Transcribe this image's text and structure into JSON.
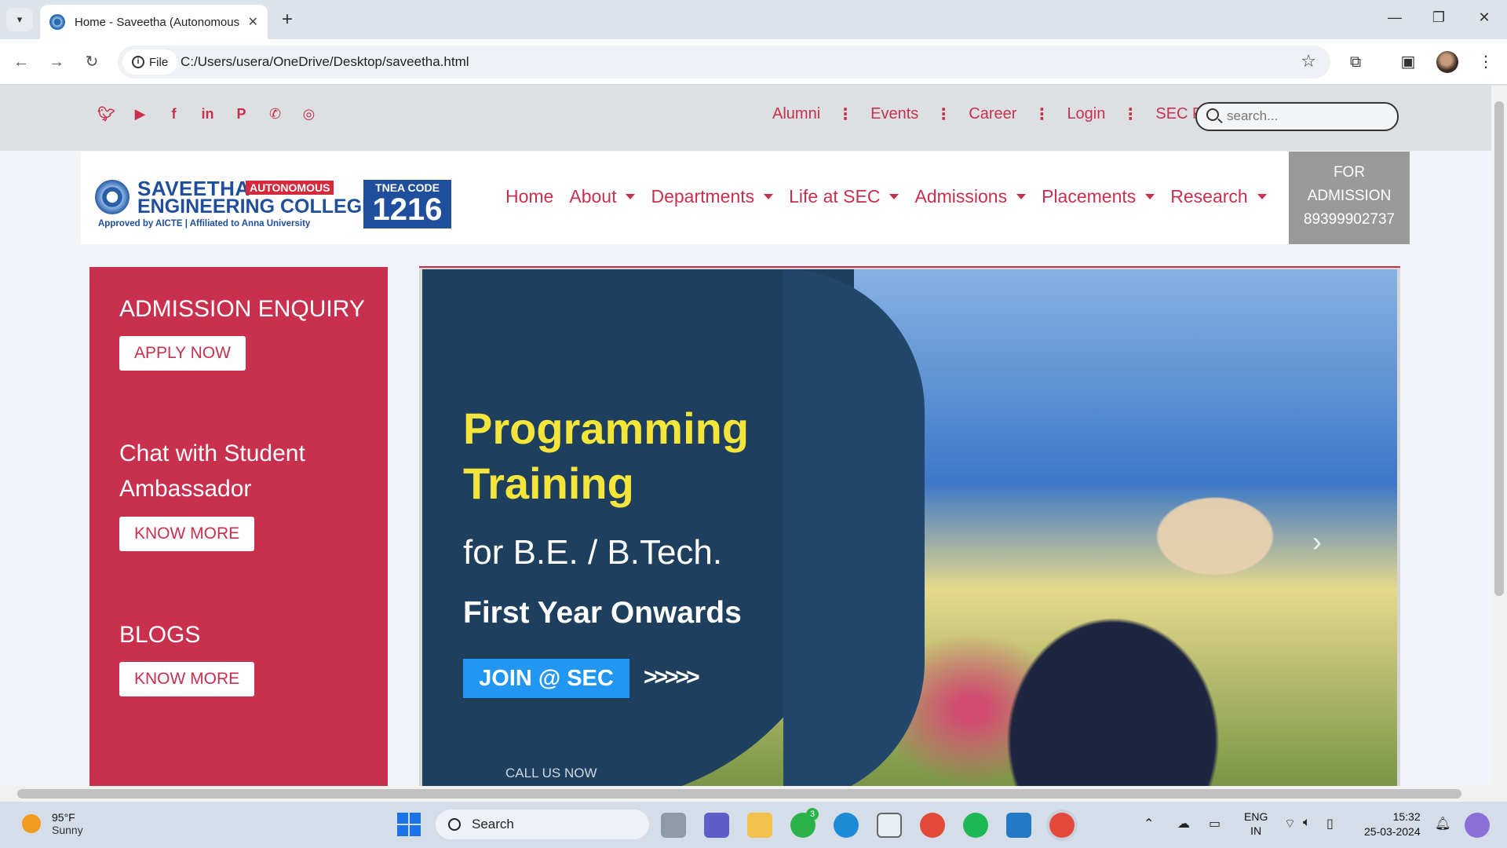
{
  "browser": {
    "tab_title": "Home - Saveetha (Autonomous",
    "site_chip": "File",
    "url": "C:/Users/usera/OneDrive/Desktop/saveetha.html"
  },
  "topbar": {
    "social_icons": [
      "twitter-icon",
      "youtube-icon",
      "facebook-icon",
      "linkedin-icon",
      "pinterest-icon",
      "whatsapp-icon",
      "instagram-icon"
    ],
    "links": [
      "Alumni",
      "Events",
      "Career",
      "Login",
      "SEC Portal"
    ],
    "search_placeholder": "search..."
  },
  "logo": {
    "name_line1": "SAVEETHA",
    "autonomous": "AUTONOMOUS",
    "name_line2": "ENGINEERING COLLEGE",
    "approved": "Approved by AICTE  |  Affiliated to Anna University",
    "tnea_label": "TNEA CODE",
    "tnea_code": "1216"
  },
  "nav": {
    "items": [
      {
        "label": "Home",
        "dropdown": false
      },
      {
        "label": "About",
        "dropdown": true
      },
      {
        "label": "Departments",
        "dropdown": true
      },
      {
        "label": "Life at SEC",
        "dropdown": true
      },
      {
        "label": "Admissions",
        "dropdown": true
      },
      {
        "label": "Placements",
        "dropdown": true
      },
      {
        "label": "Research",
        "dropdown": true
      }
    ]
  },
  "admission_box": {
    "line1": "FOR",
    "line2": "ADMISSION",
    "phone": "89399902737"
  },
  "sidepanel": {
    "enquiry_heading": "ADMISSION ENQUIRY",
    "apply_label": "APPLY NOW",
    "chat_heading": "Chat with Student Ambassador",
    "chat_button": "KNOW MORE",
    "blogs_heading": "BLOGS",
    "blogs_button": "KNOW MORE"
  },
  "slide": {
    "title_line1": "Programming",
    "title_line2": "Training",
    "subtitle": "for B.E. / B.Tech.",
    "year": "First Year Onwards",
    "join": "JOIN @ SEC",
    "arrows": ">>>>>",
    "call": "CALL US NOW"
  },
  "taskbar": {
    "temperature": "95°F",
    "weather": "Sunny",
    "search_label": "Search",
    "whatsapp_badge": "3",
    "lang1": "ENG",
    "lang2": "IN",
    "time": "15:32",
    "date": "25-03-2024"
  },
  "colors": {
    "brand": "#c8304e",
    "logo_blue": "#1f4e9c",
    "slide_yellow": "#f4e53a"
  }
}
